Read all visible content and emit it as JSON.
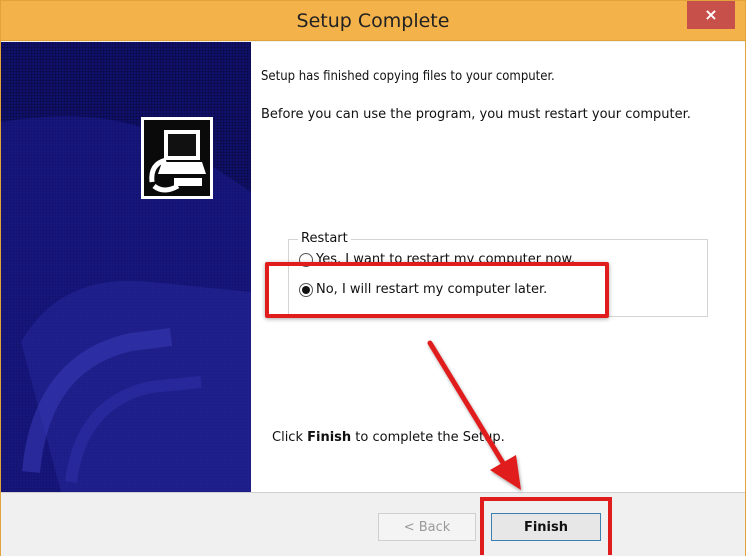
{
  "window": {
    "title": "Setup Complete",
    "close_label": "×"
  },
  "content": {
    "line1": "Setup has finished copying files to your computer.",
    "line2": "Before you can use the program, you must restart your computer.",
    "group_label": "Restart",
    "options": [
      {
        "label": "Yes, I want to restart my computer now.",
        "selected": false
      },
      {
        "label": "No, I will restart my computer later.",
        "selected": true
      }
    ],
    "finish_hint_pre": "Click ",
    "finish_hint_bold": "Finish",
    "finish_hint_post": " to complete the Setup."
  },
  "buttons": {
    "back": "< Back",
    "finish": "Finish"
  },
  "icons": {
    "setup": "setup-computer-icon",
    "close": "close-icon"
  },
  "colors": {
    "titlebar": "#f3b24a",
    "close": "#c7504a",
    "side_panel": "#10106a",
    "highlight": "#e11c1c"
  }
}
